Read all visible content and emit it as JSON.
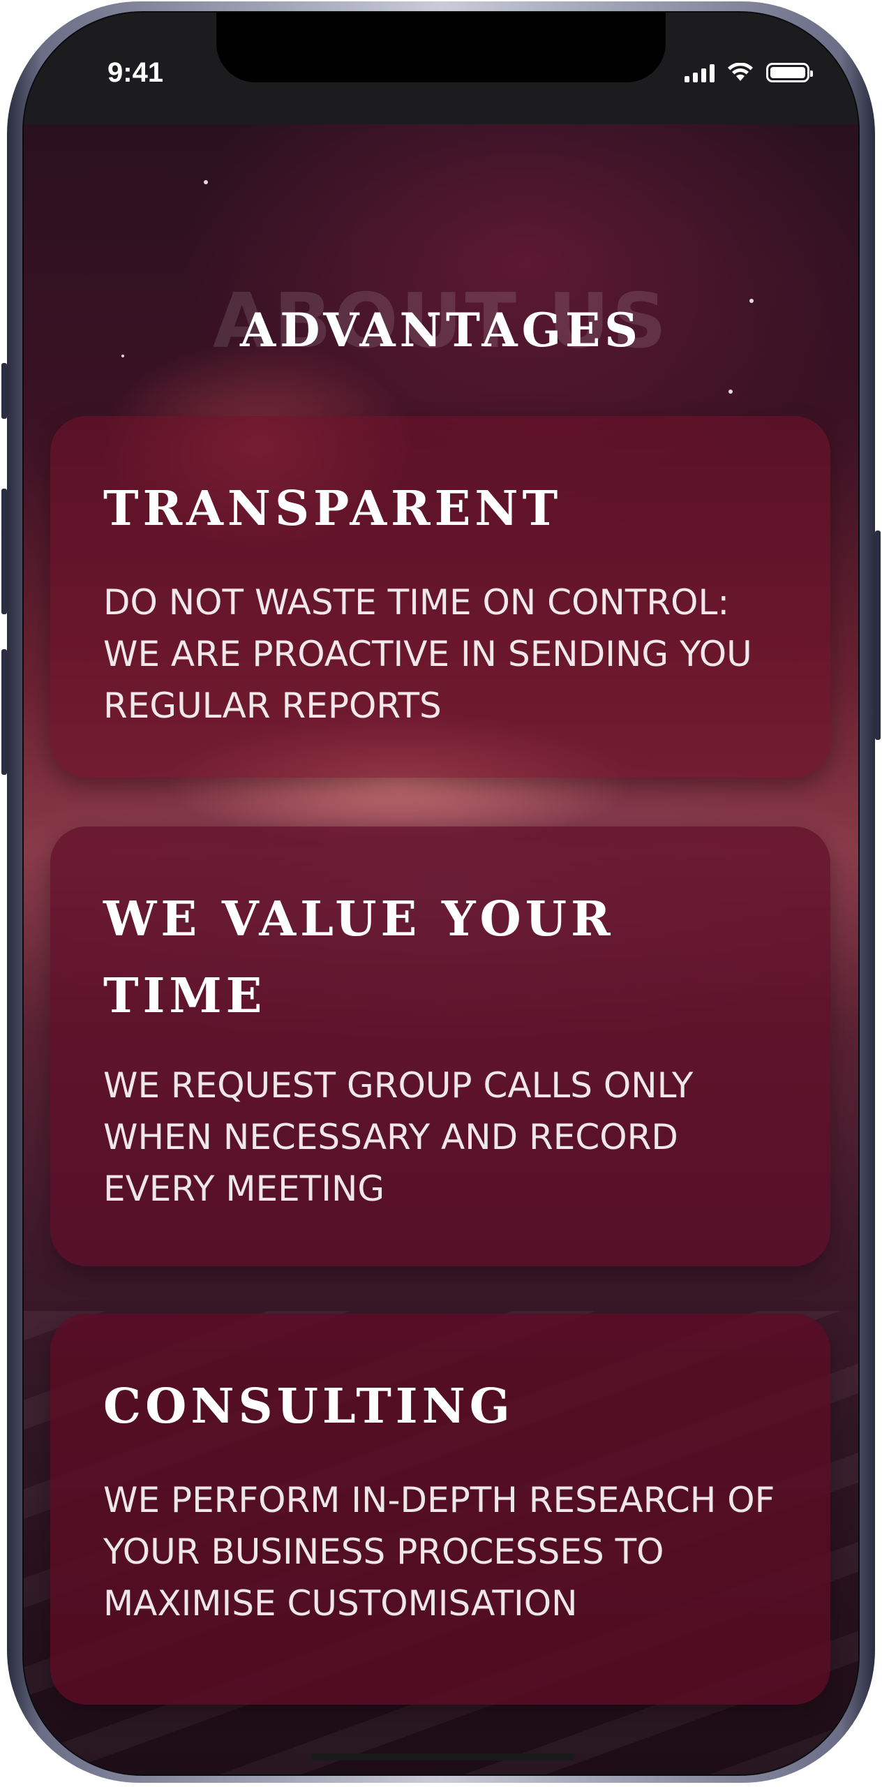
{
  "status_bar": {
    "time": "9:41",
    "signal_icon": "cellular-signal-icon",
    "wifi_icon": "wifi-icon",
    "battery_icon": "battery-icon"
  },
  "page": {
    "background_title": "ABOUT US",
    "title": "ADVANTAGES"
  },
  "cards": [
    {
      "title": "TRANSPARENT",
      "text": "DO NOT WASTE TIME ON CONTROL: WE ARE PROACTIVE IN SENDING YOU REGULAR REPORTS"
    },
    {
      "title": "WE VALUE YOUR TIME",
      "text": "WE REQUEST GROUP CALLS ONLY WHEN NECESSARY AND RECORD EVERY MEETING"
    },
    {
      "title": "CONSULTING",
      "text": "WE PERFORM IN-DEPTH RESEARCH OF YOUR BUSINESS PROCESSES TO MAXIMISE CUSTOMISATION"
    }
  ],
  "colors": {
    "card_background": "#6e122a",
    "text": "#ffffff",
    "status_bar": "#1c1c1e"
  }
}
